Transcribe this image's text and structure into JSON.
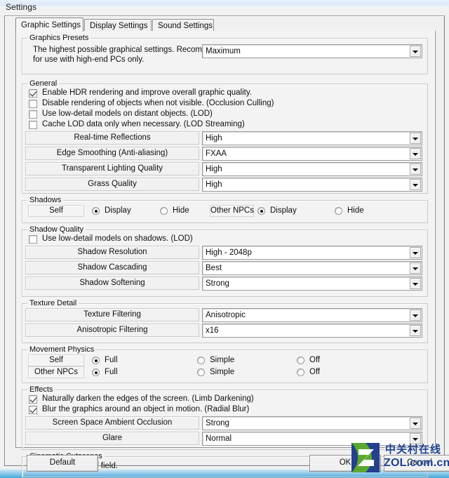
{
  "window": {
    "title": "Settings"
  },
  "tabs": [
    {
      "label": "Graphic Settings",
      "active": true
    },
    {
      "label": "Display Settings",
      "active": false
    },
    {
      "label": "Sound Settings",
      "active": false
    }
  ],
  "groups": {
    "graphics_presets": {
      "title": "Graphics Presets",
      "description_line1": "The highest possible graphical settings. Recommended",
      "description_line2": "for use with high-end PCs only.",
      "preset_value": "Maximum"
    },
    "general": {
      "title": "General",
      "checkboxes": [
        {
          "label": "Enable HDR rendering and improve overall graphic quality.",
          "checked": true
        },
        {
          "label": "Disable rendering of objects when not visible. (Occlusion Culling)",
          "checked": false
        },
        {
          "label": "Use low-detail models on distant objects. (LOD)",
          "checked": false
        },
        {
          "label": "Cache LOD data only when necessary. (LOD Streaming)",
          "checked": false
        }
      ],
      "rows": [
        {
          "label": "Real-time Reflections",
          "value": "High"
        },
        {
          "label": "Edge Smoothing (Anti-aliasing)",
          "value": "FXAA"
        },
        {
          "label": "Transparent Lighting Quality",
          "value": "High"
        },
        {
          "label": "Grass Quality",
          "value": "High"
        }
      ]
    },
    "shadows": {
      "title": "Shadows",
      "self_label": "Self",
      "self_options": [
        {
          "label": "Display",
          "selected": true
        },
        {
          "label": "Hide",
          "selected": false
        }
      ],
      "npc_label": "Other NPCs",
      "npc_options": [
        {
          "label": "Display",
          "selected": true
        },
        {
          "label": "Hide",
          "selected": false
        }
      ]
    },
    "shadow_quality": {
      "title": "Shadow Quality",
      "checkbox": {
        "label": "Use low-detail models on shadows. (LOD)",
        "checked": false
      },
      "rows": [
        {
          "label": "Shadow Resolution",
          "value": "High - 2048p"
        },
        {
          "label": "Shadow Cascading",
          "value": "Best"
        },
        {
          "label": "Shadow Softening",
          "value": "Strong"
        }
      ]
    },
    "texture_detail": {
      "title": "Texture Detail",
      "rows": [
        {
          "label": "Texture Filtering",
          "value": "Anisotropic"
        },
        {
          "label": "Anisotropic Filtering",
          "value": "x16"
        }
      ]
    },
    "movement_physics": {
      "title": "Movement Physics",
      "self_label": "Self",
      "self_options": [
        {
          "label": "Full",
          "selected": true
        },
        {
          "label": "Simple",
          "selected": false
        },
        {
          "label": "Off",
          "selected": false
        }
      ],
      "npc_label": "Other NPCs",
      "npc_options": [
        {
          "label": "Full",
          "selected": true
        },
        {
          "label": "Simple",
          "selected": false
        },
        {
          "label": "Off",
          "selected": false
        }
      ]
    },
    "effects": {
      "title": "Effects",
      "checkboxes": [
        {
          "label": "Naturally darken the edges of the screen. (Limb Darkening)",
          "checked": true
        },
        {
          "label": "Blur the graphics around an object in motion. (Radial Blur)",
          "checked": true
        }
      ],
      "rows": [
        {
          "label": "Screen Space Ambient Occlusion",
          "value": "Strong"
        },
        {
          "label": "Glare",
          "value": "Normal"
        }
      ]
    },
    "cinematic_cutscenes": {
      "title": "Cinematic Cutscenes",
      "checkbox": {
        "label": "Enable depth of field.",
        "checked": true
      }
    }
  },
  "footer": {
    "default_label": "Default",
    "ok_label": "OK",
    "cancel_label": "Cancel"
  },
  "watermark": {
    "chinese": "中关村在线",
    "english": "ZOL.com.cn",
    "blue": "#1b3f8f",
    "green": "#5aa82e"
  }
}
